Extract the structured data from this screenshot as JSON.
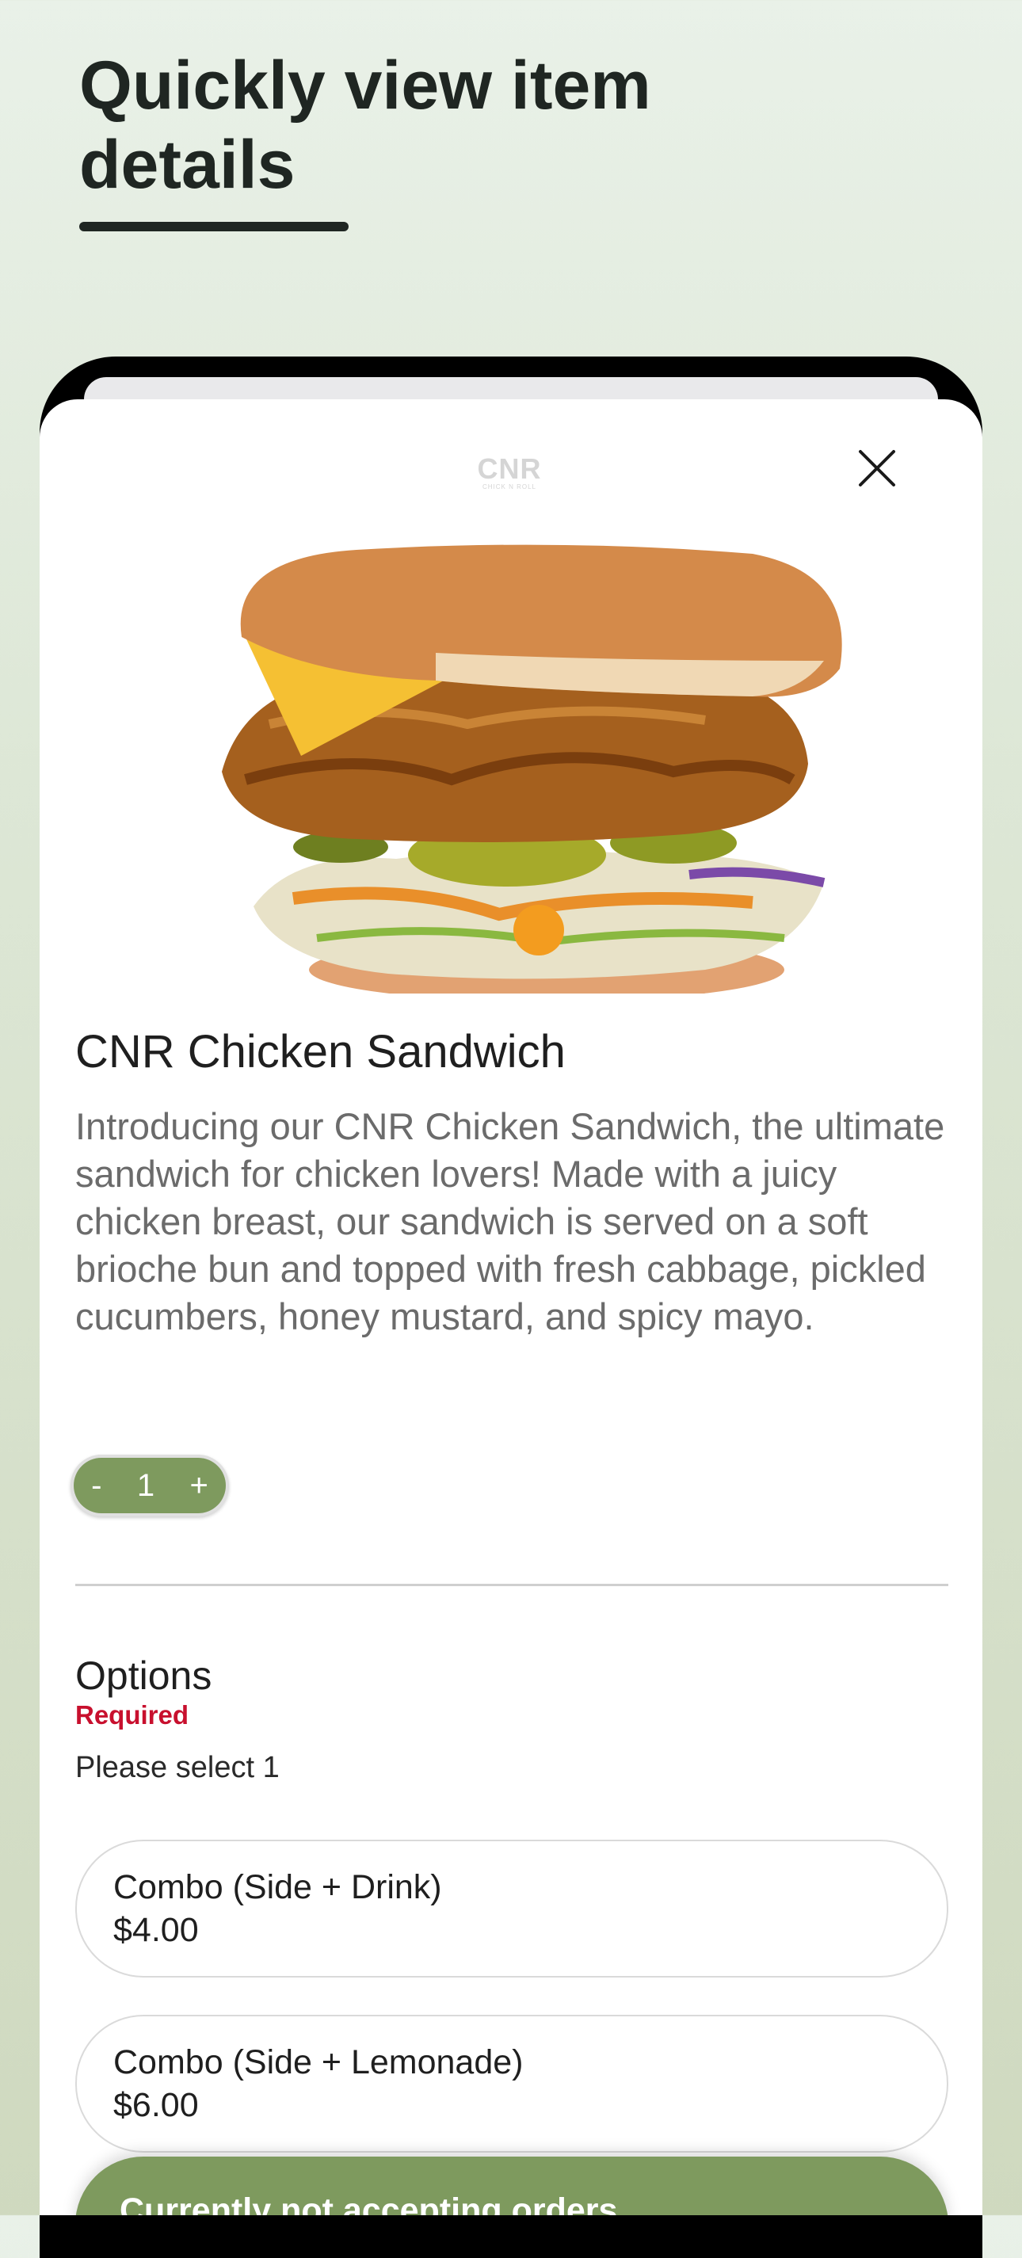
{
  "headline": "Quickly view item details",
  "brand": {
    "logo_text": "CNR",
    "logo_subtext": "CHICK N ROLL"
  },
  "item": {
    "title": "CNR Chicken Sandwich",
    "description": "Introducing our CNR Chicken Sandwich, the ultimate sandwich for chicken lovers! Made with a juicy chicken breast, our sandwich is served on a soft brioche bun and topped with fresh cabbage, pickled cucumbers, honey mustard, and spicy mayo.",
    "image_icon": "chicken-sandwich-photo"
  },
  "quantity": {
    "minus": "-",
    "value": "1",
    "plus": "+"
  },
  "options": {
    "title": "Options",
    "required_label": "Required",
    "hint": "Please select 1",
    "choices": [
      {
        "name": "Combo (Side + Drink)",
        "price": "$4.00"
      },
      {
        "name": "Combo (Side + Lemonade)",
        "price": "$6.00"
      }
    ]
  },
  "status_button": {
    "label": "Currently not accepting orders"
  },
  "colors": {
    "accent": "#7e9a5e",
    "required": "#c8102e",
    "headline": "#1f2622"
  },
  "icons": {
    "close": "close-icon"
  }
}
